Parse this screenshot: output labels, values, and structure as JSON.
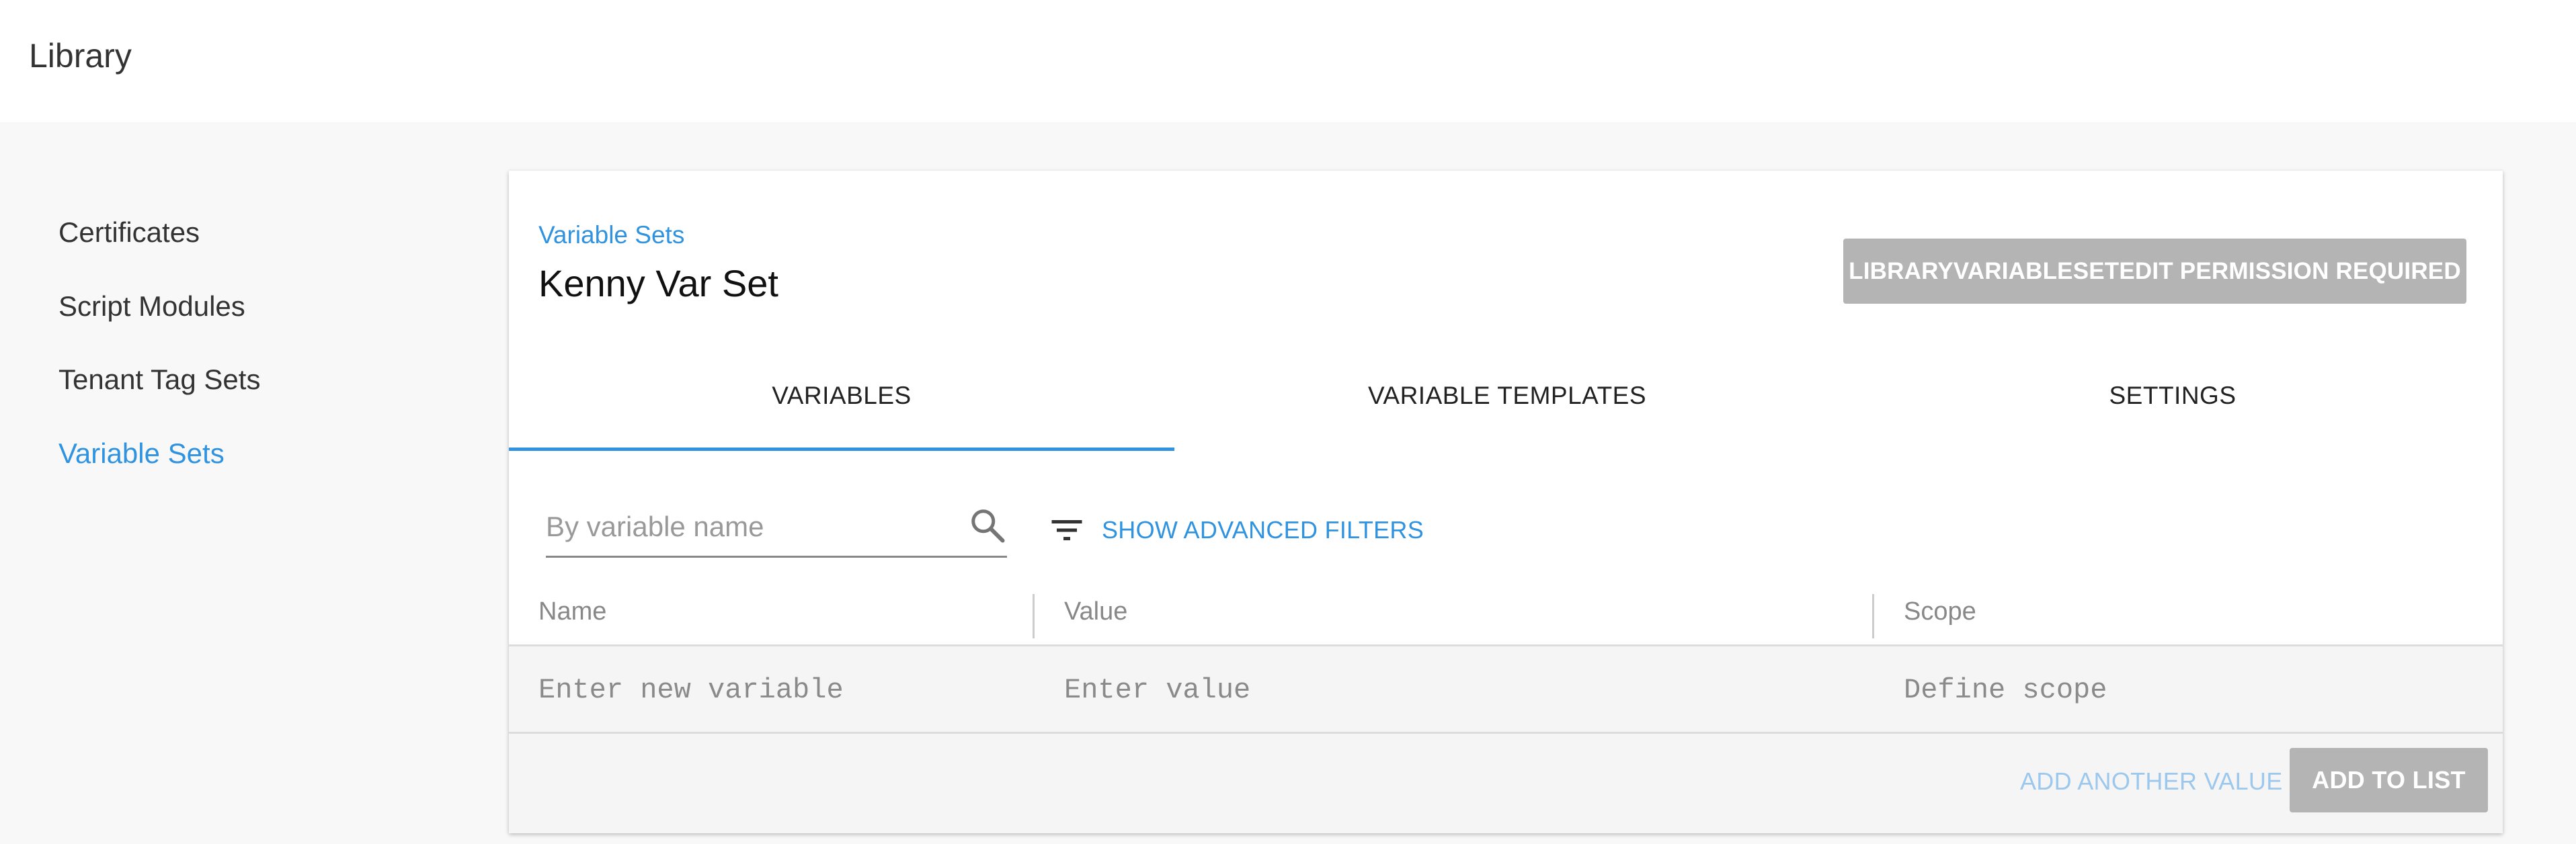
{
  "header": {
    "title": "Library"
  },
  "sidebar": {
    "items": [
      {
        "label": "Certificates",
        "active": false
      },
      {
        "label": "Script Modules",
        "active": false
      },
      {
        "label": "Tenant Tag Sets",
        "active": false
      },
      {
        "label": "Variable Sets",
        "active": true
      }
    ]
  },
  "page": {
    "breadcrumb": "Variable Sets",
    "title": "Kenny Var Set",
    "permission_button": "LIBRARYVARIABLESETEDIT PERMISSION REQUIRED"
  },
  "tabs": [
    {
      "label": "VARIABLES",
      "active": true
    },
    {
      "label": "VARIABLE TEMPLATES",
      "active": false
    },
    {
      "label": "SETTINGS",
      "active": false
    }
  ],
  "filters": {
    "search_placeholder": "By variable name",
    "search_value": "",
    "advanced_label": "SHOW ADVANCED FILTERS"
  },
  "table": {
    "columns": [
      "Name",
      "Value",
      "Scope"
    ],
    "new_row": {
      "name_placeholder": "Enter new variable",
      "value_placeholder": "Enter value",
      "scope_placeholder": "Define scope"
    },
    "add_another_label": "ADD ANOTHER VALUE",
    "add_to_list_label": "ADD TO LIST"
  },
  "colors": {
    "accent": "#2f93e0",
    "disabled_button": "#b4b4b4",
    "background": "#f8f8f8"
  },
  "icons": {
    "search": "search-icon",
    "filter": "filter-list-icon"
  }
}
